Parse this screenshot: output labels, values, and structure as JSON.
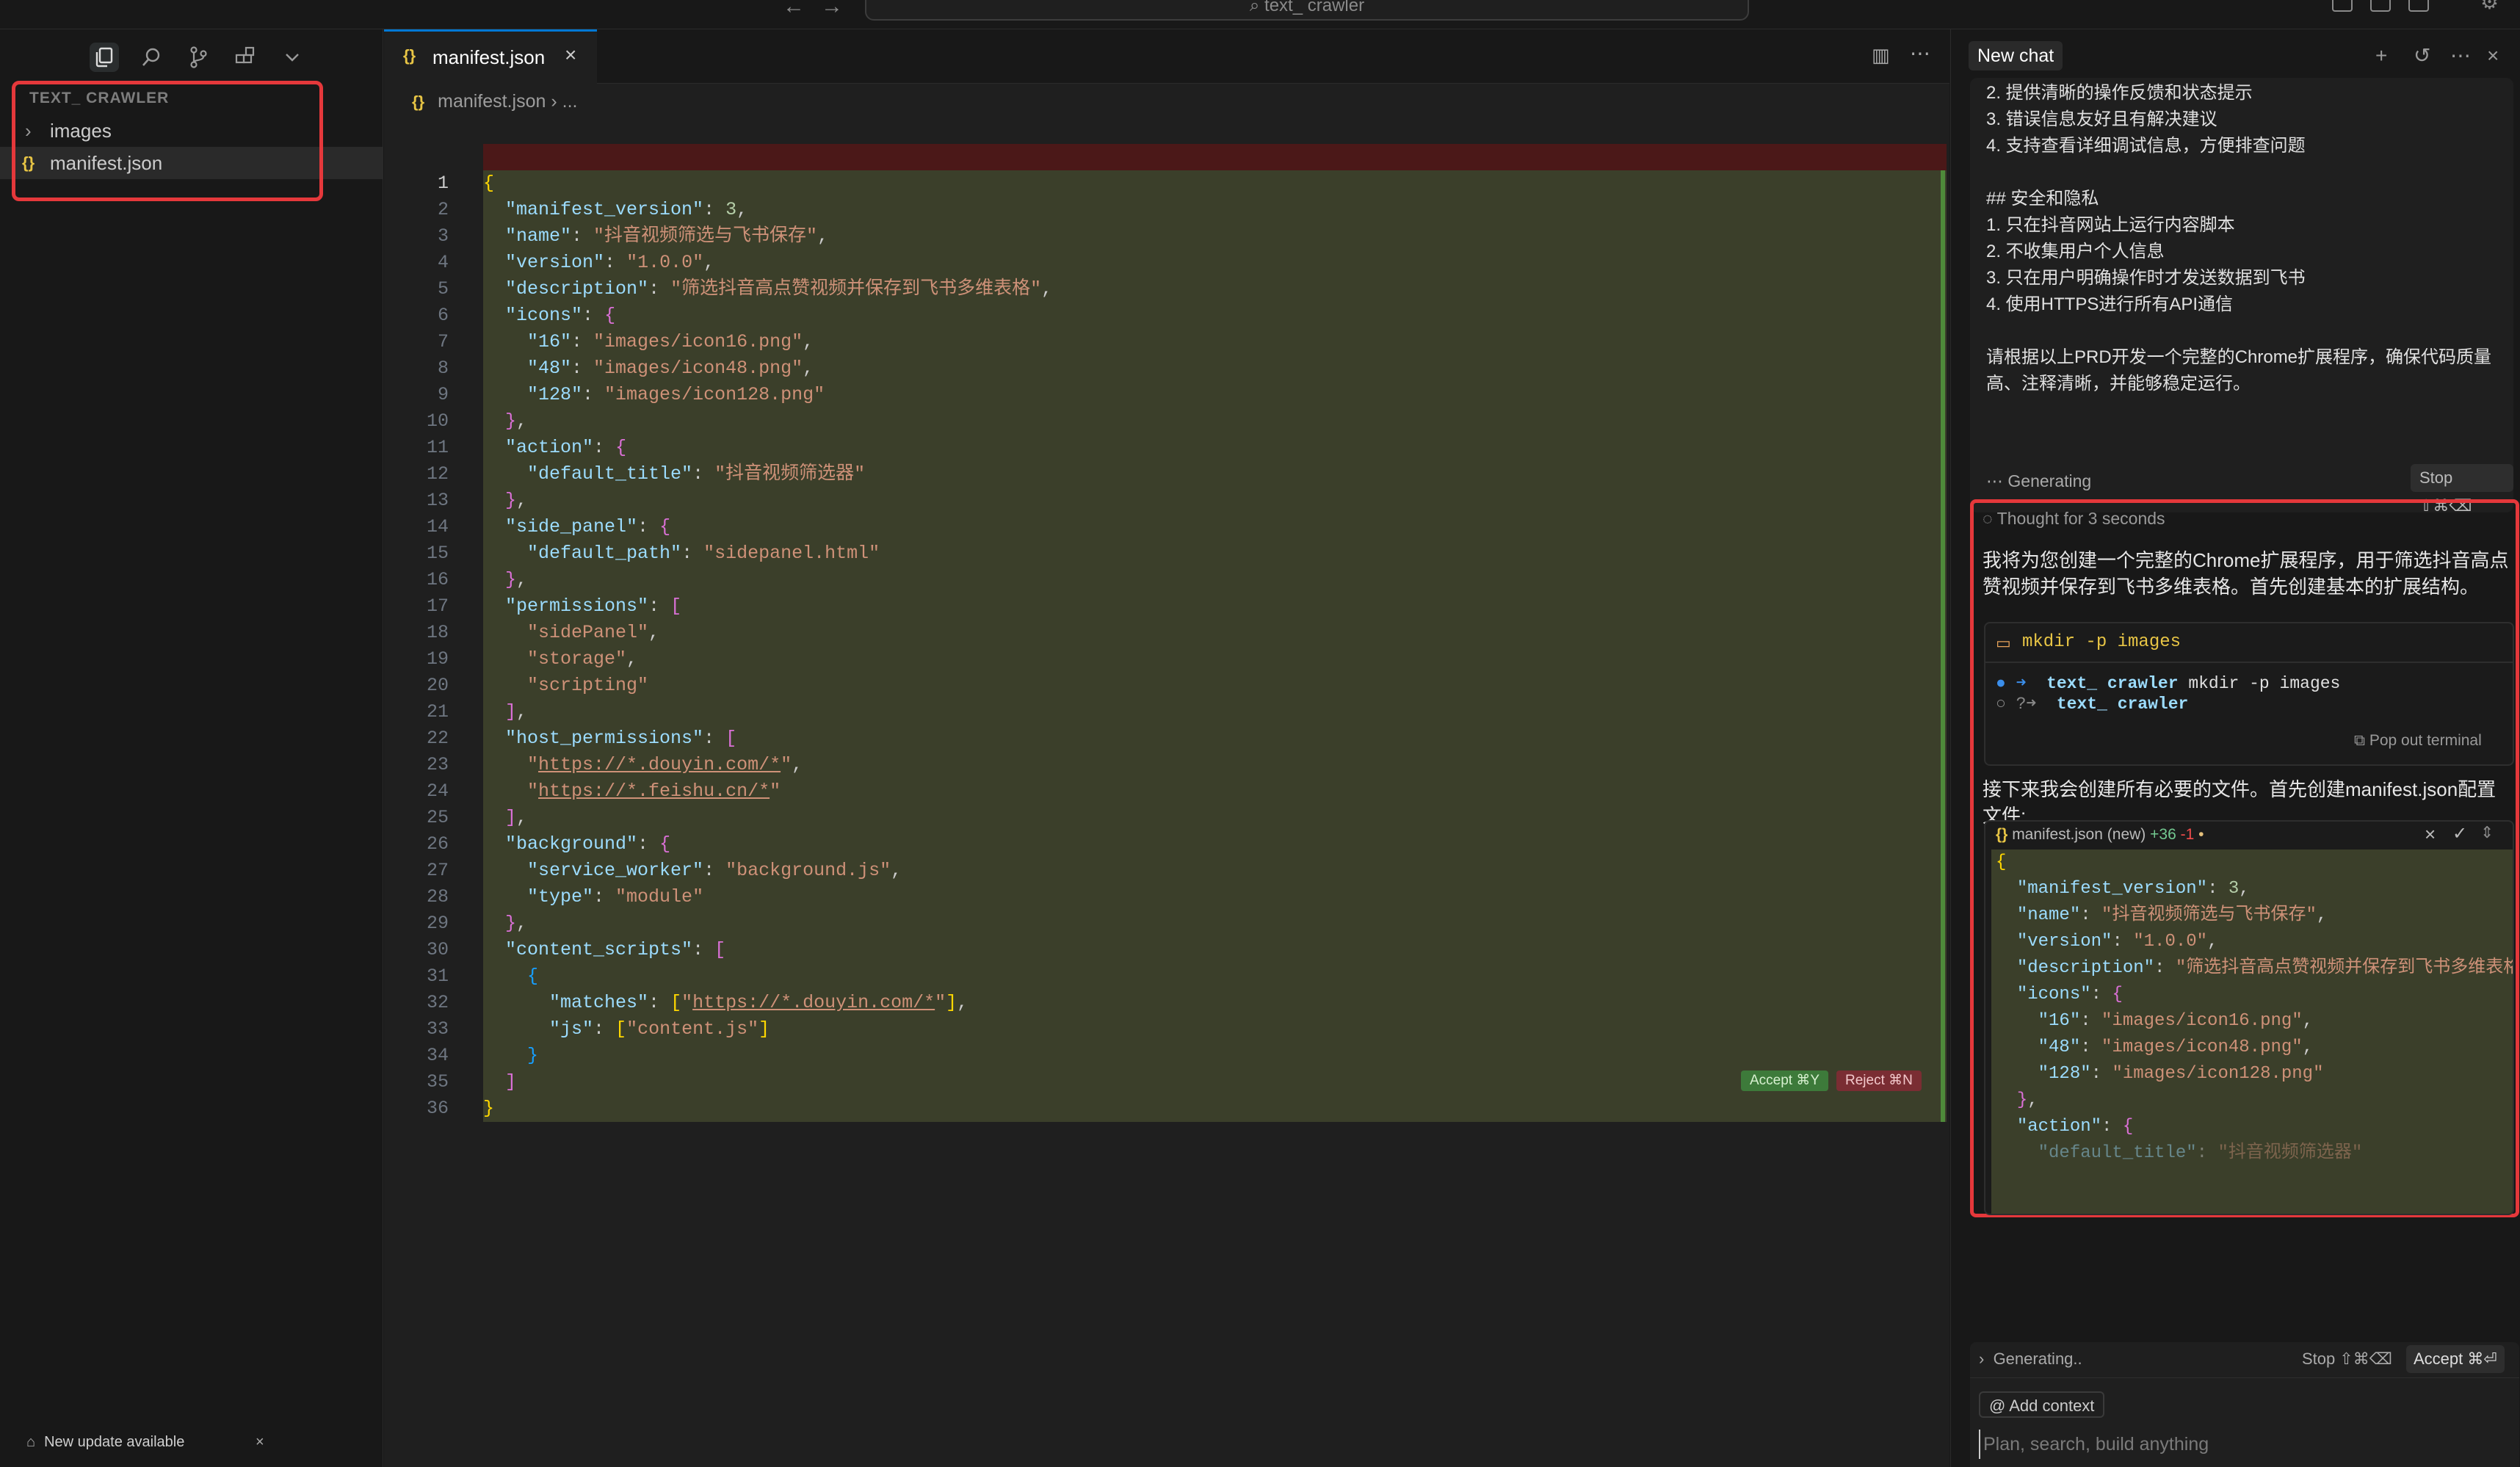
{
  "titlebar": {
    "search_text": "text_ crawler"
  },
  "sidebar": {
    "explorer_title": "TEXT_ CRAWLER",
    "items": [
      {
        "label": "images",
        "type": "folder"
      },
      {
        "label": "manifest.json",
        "type": "json",
        "selected": true
      }
    ],
    "update_toast": "New update available"
  },
  "editor": {
    "tab_label": "manifest.json",
    "breadcrumb": "manifest.json",
    "breadcrumb_more": "...",
    "accept_label": "Accept ⌘Y",
    "reject_label": "Reject ⌘N",
    "line_count": 36
  },
  "chat": {
    "title": "New chat",
    "prev_message_lines": [
      "2. 提供清晰的操作反馈和状态提示",
      "3. 错误信息友好且有解决建议",
      "4. 支持查看详细调试信息，方便排查问题",
      "",
      "## 安全和隐私",
      "1. 只在抖音网站上运行内容脚本",
      "2. 不收集用户个人信息",
      "3. 只在用户明确操作时才发送数据到飞书",
      "4. 使用HTTPS进行所有API通信",
      "",
      "请根据以上PRD开发一个完整的Chrome扩展程序，确保代码质量",
      "高、注释清晰，并能够稳定运行。"
    ],
    "generating_label": "Generating",
    "stop_label": "Stop ⇧⌘⌫",
    "thought_label": "Thought for 3 seconds",
    "response_para1": "我将为您创建一个完整的Chrome扩展程序，用于筛选抖音高点赞视频并保存到飞书多维表格。首先创建基本的扩展结构。",
    "terminal": {
      "command": "mkdir -p images",
      "line1_dir": "text_ crawler",
      "line1_cmd": "mkdir -p images",
      "line2_dir": "text_ crawler",
      "pop_out": "Pop out terminal"
    },
    "response_para2": "接下来我会创建所有必要的文件。首先创建manifest.json配置文件:",
    "edit_card": {
      "file": "manifest.json",
      "status": "(new)",
      "added": "+36",
      "removed": "-1"
    },
    "bottom": {
      "generating": "Generating..",
      "stop": "Stop ⇧⌘⌫",
      "accept": "Accept ⌘⏎",
      "add_context": "Add context",
      "input_placeholder": "Plan, search, build anything"
    }
  },
  "colors": {
    "accent_red": "#e5383b",
    "diff_green_bg": "#3b3f2a",
    "diff_red_bg": "#4b1818"
  }
}
